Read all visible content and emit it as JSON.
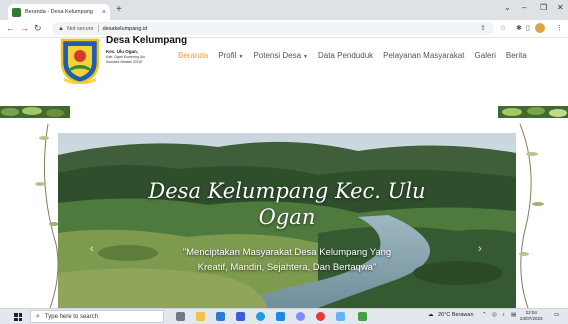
{
  "browser": {
    "tab_title": "Beranda - Desa Kelumpang",
    "tab_close": "×",
    "new_tab": "+",
    "window_controls": [
      "⌄",
      "–",
      "❐",
      "✕"
    ],
    "security_label": "Not secure",
    "url": "desakelumpang.id"
  },
  "site": {
    "brand": {
      "name": "Desa Kelumpang",
      "line1": "Kec. Ulu Ogan,",
      "line2": "Kab. Ogan Komering Ulu,",
      "line3": "Sumatra Selatan 32187"
    },
    "menu": [
      {
        "label": "Beranda",
        "active": true,
        "dropdown": false
      },
      {
        "label": "Profil",
        "active": false,
        "dropdown": true
      },
      {
        "label": "Potensi Desa",
        "active": false,
        "dropdown": true
      },
      {
        "label": "Data Penduduk",
        "active": false,
        "dropdown": false
      },
      {
        "label": "Pelayanan Masyarakat",
        "active": false,
        "dropdown": false
      },
      {
        "label": "Galeri",
        "active": false,
        "dropdown": false
      },
      {
        "label": "Berita",
        "active": false,
        "dropdown": false
      }
    ],
    "hero": {
      "title_line1": "Desa Kelumpang Kec. Ulu",
      "title_line2": "Ogan",
      "subtitle_line1": "\"Menciptakan Masyarakat Desa Kelumpang Yang",
      "subtitle_line2": "Kreatif, Mandiri, Sejahtera, Dan Bertaqwa\"",
      "prev_arrow": "‹",
      "next_arrow": "›"
    }
  },
  "taskbar": {
    "search_placeholder": "Type here to search",
    "weather": "26°C  Berawan",
    "time": "22:04",
    "date": "24/07/2023"
  },
  "colors": {
    "menu_active": "#e8a33b",
    "menu_inactive": "#555555",
    "taskbar": "#e3e8ef"
  }
}
